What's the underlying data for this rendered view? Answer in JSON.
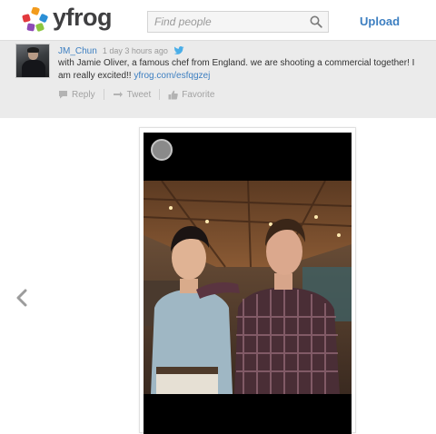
{
  "header": {
    "logo_text": "yfrog",
    "search_placeholder": "Find people",
    "upload_label": "Upload"
  },
  "tweet": {
    "username": "JM_Chun",
    "timestamp": "1 day 3 hours ago",
    "text": "with Jamie Oliver, a famous chef from England. we are shooting a commercial together! I am really excited!!",
    "link": "yfrog.com/esfqgzej",
    "actions": {
      "reply": "Reply",
      "tweet": "Tweet",
      "favorite": "Favorite"
    }
  },
  "icons": {
    "search": "search-icon",
    "bird": "twitter-bird-icon",
    "reply": "reply-icon",
    "retweet": "retweet-icon",
    "favorite": "thumbs-up-icon",
    "prev": "chevron-left-icon"
  },
  "colors": {
    "link_blue": "#3d7fc1",
    "tweet_bg": "#ebebeb",
    "text_dark": "#333333",
    "muted": "#a2a2a2",
    "logo_orange": "#f29b1d",
    "logo_red": "#e2393d",
    "logo_green": "#8cc63f",
    "logo_blue": "#2b8fd6",
    "logo_purple": "#8e4bb6"
  }
}
